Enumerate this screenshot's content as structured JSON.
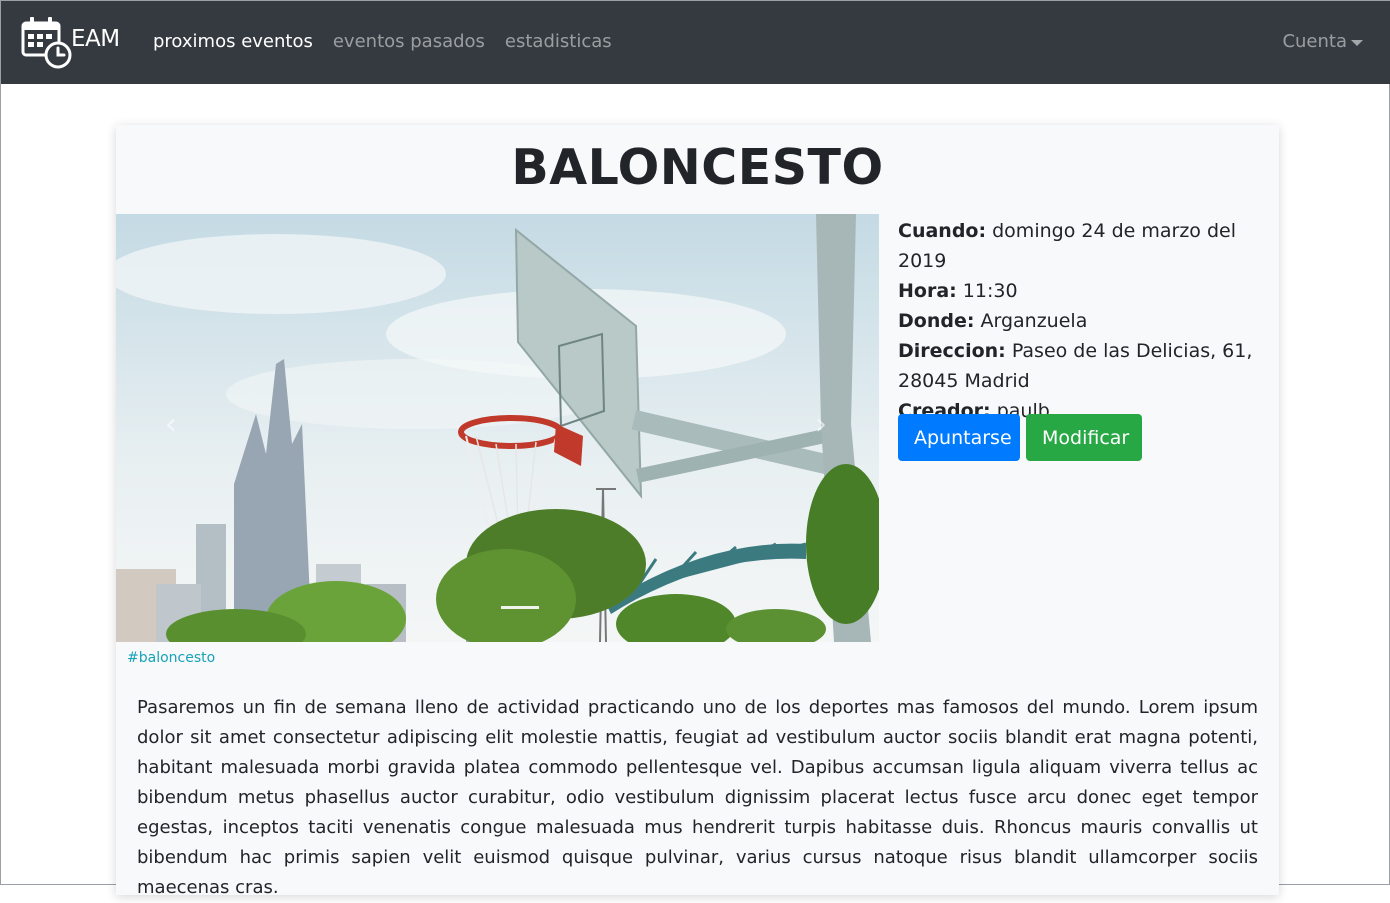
{
  "navbar": {
    "brand": "EAM",
    "links": [
      {
        "label": "proximos eventos",
        "active": true
      },
      {
        "label": "eventos pasados",
        "active": false
      },
      {
        "label": "estadisticas",
        "active": false
      }
    ],
    "account_label": "Cuenta",
    "brand_icon": "calendar-clock-icon"
  },
  "event": {
    "title": "BALONCESTO",
    "tag": "#baloncesto",
    "cuando_label": "Cuando:",
    "cuando": "domingo 24 de marzo del 2019",
    "hora_label": "Hora:",
    "hora": "11:30",
    "donde_label": "Donde:",
    "donde": "Arganzuela",
    "direccion_label": "Direccion:",
    "direccion": "Paseo de las Delicias, 61, 28045 Madrid",
    "creador_label": "Creador:",
    "creador": "paulb",
    "description": "Pasaremos un fin de semana lleno de actividad practicando uno de los deportes mas famosos del mundo. Lorem ipsum dolor sit amet consectetur adipiscing elit molestie mattis, feugiat ad vestibulum auctor sociis blandit erat magna potenti, habitant malesuada morbi gravida platea commodo pellentesque vel. Dapibus accumsan ligula aliquam viverra tellus ac bibendum metus phasellus auctor curabitur, odio vestibulum dignissim placerat lectus fusce arcu donec eget tempor egestas, inceptos taciti venenatis congue malesuada mus hendrerit turpis habitasse duis. Rhoncus mauris convallis ut bibendum hac primis sapien velit euismod quisque pulvinar, varius cursus natoque risus blandit ullamcorper sociis maecenas cras."
  },
  "buttons": {
    "join_label": "Apuntarse",
    "edit_label": "Modificar"
  },
  "carousel": {
    "prev_icon": "chevron-left-icon",
    "next_icon": "chevron-right-icon"
  },
  "colors": {
    "navbar_bg": "#343a40",
    "primary": "#007bff",
    "success": "#28a745",
    "tag": "#17a2b8",
    "card_bg": "#f8f9fa"
  }
}
